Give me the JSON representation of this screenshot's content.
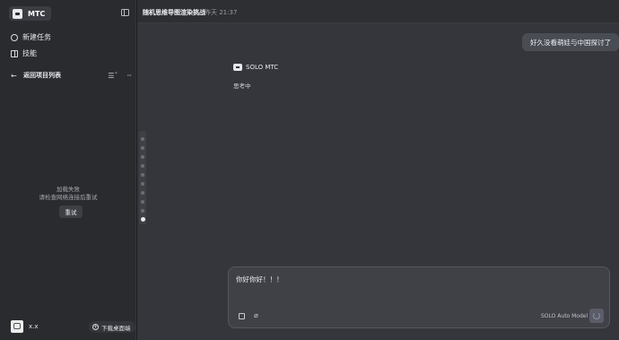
{
  "app": {
    "name": "MTC"
  },
  "sidebar": {
    "nav": [
      {
        "label": "新建任务",
        "icon": "chat-plus-icon"
      },
      {
        "label": "技能",
        "icon": "book-icon"
      }
    ],
    "project_list": {
      "back_label": "返回项目列表",
      "error_title": "加载失败",
      "error_desc": "请检查网络连接后重试",
      "retry_label": "重试"
    },
    "user": {
      "name": "x.x"
    },
    "download_label": "下载桌面端"
  },
  "header": {
    "title": "随机思维导图渲染挑战",
    "time": "昨天 21:37"
  },
  "chat": {
    "user_message": "好久没看萌娃与中国探讨了",
    "assistant_name": "SOLO MTC",
    "assistant_status": "思考中"
  },
  "composer": {
    "text": "你好你好！！！",
    "model_label": "SOLO Auto Model"
  }
}
